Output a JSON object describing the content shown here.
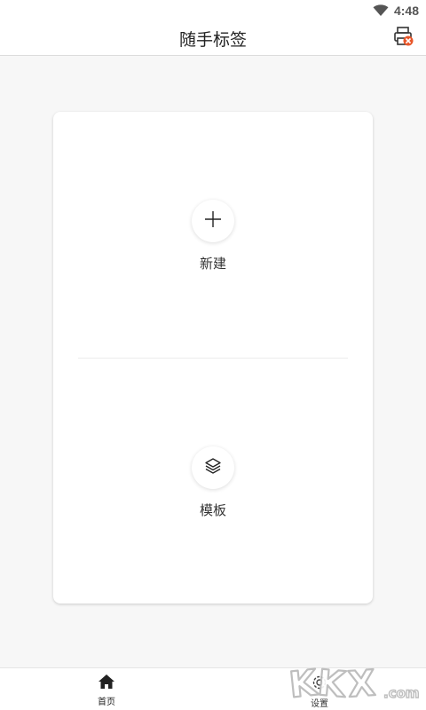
{
  "status_bar": {
    "time": "4:48",
    "icons": [
      "wifi-icon"
    ]
  },
  "app_bar": {
    "title": "随手标签",
    "action_icon": "printer-error-icon"
  },
  "card": {
    "actions": [
      {
        "label": "新建",
        "icon": "plus-icon"
      },
      {
        "label": "模板",
        "icon": "layers-icon"
      }
    ]
  },
  "bottom_nav": {
    "items": [
      {
        "label": "首页",
        "icon": "home-icon",
        "active": true
      },
      {
        "label": "设置",
        "icon": "gear-icon",
        "active": false
      }
    ]
  },
  "watermark": {
    "text": "KKX.com"
  },
  "colors": {
    "accent": "#e8562a",
    "background": "#f7f7f7",
    "card": "#ffffff"
  }
}
